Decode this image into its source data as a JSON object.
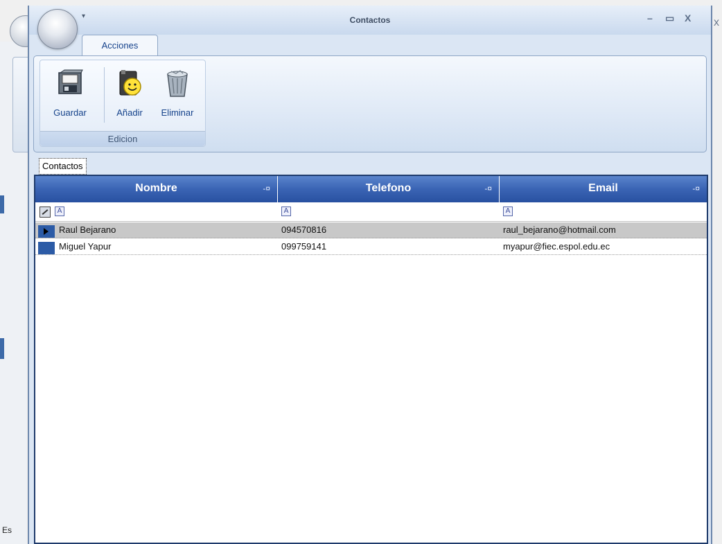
{
  "window": {
    "title": "Contactos",
    "ribbon_tab": "Acciones",
    "controls": {
      "minimize": "–",
      "maximize": "▭",
      "close": "X"
    }
  },
  "ribbon": {
    "group_label": "Edicion",
    "buttons": [
      {
        "label": "Guardar",
        "icon": "save-icon"
      },
      {
        "label": "Añadir",
        "icon": "add-contact-icon"
      },
      {
        "label": "Eliminar",
        "icon": "trash-icon"
      }
    ]
  },
  "doc_tab": "Contactos",
  "grid": {
    "columns": [
      "Nombre",
      "Telefono",
      "Email"
    ],
    "rows": [
      {
        "nombre": "Raul Bejarano",
        "telefono": "094570816",
        "email": "raul_bejarano@hotmail.com",
        "selected": true
      },
      {
        "nombre": "Miguel Yapur",
        "telefono": "099759141",
        "email": "myapur@fiec.espol.edu.ec",
        "selected": false
      }
    ]
  },
  "background": {
    "status_text": "Es",
    "close": "x"
  }
}
